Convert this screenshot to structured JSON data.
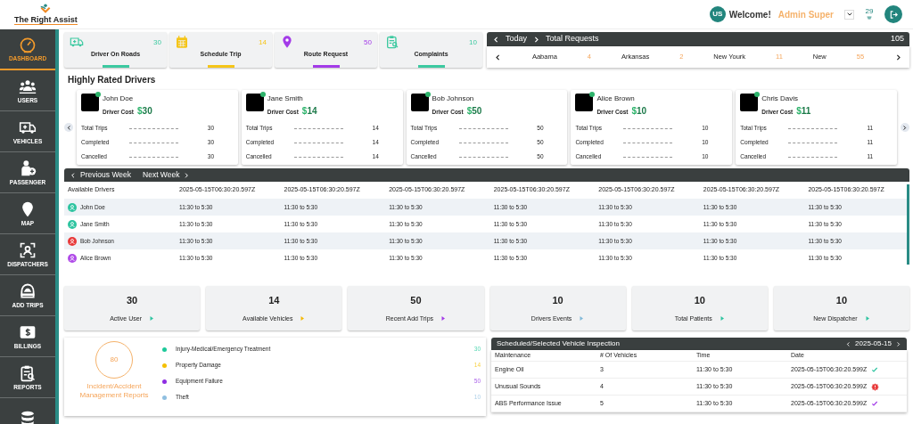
{
  "header": {
    "logo": "The Right Assist",
    "avatar": "US",
    "welcome": "Welcome!",
    "user": "Admin Super",
    "notifications": "29"
  },
  "sidebar": {
    "items": [
      {
        "label": "DASHBOARD",
        "selected": true
      },
      {
        "label": "USERS",
        "selected": false
      },
      {
        "label": "VEHICLES",
        "selected": false
      },
      {
        "label": "PASSENGER",
        "selected": false
      },
      {
        "label": "MAP",
        "selected": false
      },
      {
        "label": "DISPATCHERS",
        "selected": false
      },
      {
        "label": "ADD TRIPS",
        "selected": false
      },
      {
        "label": "BILLINGS",
        "selected": false
      },
      {
        "label": "REPORTS",
        "selected": false
      },
      {
        "selected": false
      }
    ]
  },
  "stat_cards": [
    {
      "label": "Driver On Roads",
      "value": "30",
      "color": "#3cc9a0"
    },
    {
      "label": "Schedule Trip",
      "value": "14",
      "color": "#f5c518"
    },
    {
      "label": "Route Request",
      "value": "50",
      "color": "#a33be8"
    },
    {
      "label": "Complaints",
      "value": "10",
      "color": "#3cc9a0"
    }
  ],
  "total_requests": {
    "period": "Today",
    "title": "Total Requests",
    "total": "105",
    "states": [
      {
        "name": "Aabama",
        "count": "4"
      },
      {
        "name": "Arkansas",
        "count": "2"
      },
      {
        "name": "New Yourk",
        "count": "11"
      },
      {
        "name": "New",
        "count": "55"
      }
    ]
  },
  "rated_drivers": {
    "title": "Highly Rated Drivers",
    "drivers": [
      {
        "name": "John Doe",
        "online": true,
        "cost_label": "Driver Cost",
        "currency": "$",
        "cost": "30",
        "stats": [
          {
            "label": "Total Trips",
            "value": "30"
          },
          {
            "label": "Completed",
            "value": "30"
          },
          {
            "label": "Cancelled",
            "value": "30"
          }
        ]
      },
      {
        "name": "Jane Smith",
        "online": true,
        "cost_label": "Driver Cost",
        "currency": "$",
        "cost": "14",
        "stats": [
          {
            "label": "Total Trips",
            "value": "14"
          },
          {
            "label": "Completed",
            "value": "14"
          },
          {
            "label": "Cancelled",
            "value": "14"
          }
        ]
      },
      {
        "name": "Bob Johnson",
        "online": true,
        "cost_label": "Driver Cost",
        "currency": "$",
        "cost": "50",
        "stats": [
          {
            "label": "Total Trips",
            "value": "50"
          },
          {
            "label": "Completed",
            "value": "50"
          },
          {
            "label": "Cancelled",
            "value": "50"
          }
        ]
      },
      {
        "name": "Alice Brown",
        "online": true,
        "cost_label": "Driver Cost",
        "currency": "$",
        "cost": "10",
        "stats": [
          {
            "label": "Total Trips",
            "value": "10"
          },
          {
            "label": "Completed",
            "value": "10"
          },
          {
            "label": "Cancelled",
            "value": "10"
          }
        ]
      },
      {
        "name": "Chris Davis",
        "online": true,
        "cost_label": "Driver Cost",
        "currency": "$",
        "cost": "11",
        "stats": [
          {
            "label": "Total Trips",
            "value": "11"
          },
          {
            "label": "Completed",
            "value": "11"
          },
          {
            "label": "Cancelled",
            "value": "11"
          }
        ]
      }
    ]
  },
  "schedule": {
    "previous": "Previous Week",
    "next": "Next Week",
    "columns": [
      "Available Drivers",
      "2025-05-15T06:30:20.597Z",
      "2025-05-15T06:30:20.597Z",
      "2025-05-15T06:30:20.597Z",
      "2025-05-15T06:30:20.597Z",
      "2025-05-15T06:30:20.597Z",
      "2025-05-15T06:30:20.597Z",
      "2025-05-15T06:30:20.597Z"
    ],
    "rows": [
      {
        "color": "#2ec4a0",
        "cells": [
          "John Doe",
          "11:30 to 5:30",
          "11:30 to 5:30",
          "11:30 to 5:30",
          "11:30 to 5:30",
          "11:30 to 5:30",
          "11:30 to 5:30",
          "11:30 to 5:30"
        ]
      },
      {
        "color": "#2ec4a0",
        "cells": [
          "Jane Smith",
          "11:30 to 5:30",
          "11:30 to 5:30",
          "11:30 to 5:30",
          "11:30 to 5:30",
          "11:30 to 5:30",
          "11:30 to 5:30",
          "11:30 to 5:30"
        ]
      },
      {
        "color": "#e83a3a",
        "cells": [
          "Bob Johnson",
          "11:30 to 5:30",
          "11:30 to 5:30",
          "11:30 to 5:30",
          "11:30 to 5:30",
          "11:30 to 5:30",
          "11:30 to 5:30",
          "11:30 to 5:30"
        ]
      },
      {
        "color": "#b04be8",
        "cells": [
          "Alice Brown",
          "11:30 to 5:30",
          "11:30 to 5:30",
          "11:30 to 5:30",
          "11:30 to 5:30",
          "11:30 to 5:30",
          "11:30 to 5:30",
          "11:30 to 5:30"
        ]
      }
    ]
  },
  "summary_cards": [
    {
      "value": "30",
      "label": "Active User",
      "color": "#2ec4a0"
    },
    {
      "value": "14",
      "label": "Available Vehicles",
      "color": "#f5b800"
    },
    {
      "value": "50",
      "label": "Recent Add Trips",
      "color": "#a33be8"
    },
    {
      "value": "10",
      "label": "Drivers Events",
      "color": "#7fb8d8"
    },
    {
      "value": "10",
      "label": "Total Patients",
      "color": "#2ec4a0"
    },
    {
      "value": "10",
      "label": "New Dispatcher",
      "color": "#2ec4a0"
    }
  ],
  "incidents": {
    "total": "80",
    "title": "Incident/Accident Management Reports",
    "items": [
      {
        "label": "Injury-Medical/Emergency Treatment",
        "value": "30",
        "color": "#1dc99a"
      },
      {
        "label": "Property Damage",
        "value": "14",
        "color": "#f5c000"
      },
      {
        "label": "Equipment Failure",
        "value": "50",
        "color": "#8e2de2"
      },
      {
        "label": "Theft",
        "value": "10",
        "color": "#8fbfe0"
      }
    ]
  },
  "inspection": {
    "title": "Scheduled/Selected Vehicle Inspection",
    "date": "2025-05-15",
    "columns": [
      "Maintenance",
      "# Of Vehicles",
      "Time",
      "Date"
    ],
    "rows": [
      {
        "maintenance": "Engine Oil",
        "vehicles": "3",
        "time": "11:30 to 5:30",
        "date": "2025-05-15T06:30:20.599Z",
        "kind": "check",
        "color": "#2ec4a0"
      },
      {
        "maintenance": "Unusual Sounds",
        "vehicles": "4",
        "time": "11:30 to 5:30",
        "date": "2025-05-15T06:30:20.599Z",
        "kind": "alert",
        "color": "#e83a3a"
      },
      {
        "maintenance": "ABS Performance Issue",
        "vehicles": "5",
        "time": "11:30 to 5:30",
        "date": "2025-05-15T06:30:20.599Z",
        "kind": "check",
        "color": "#a33be8"
      }
    ]
  }
}
